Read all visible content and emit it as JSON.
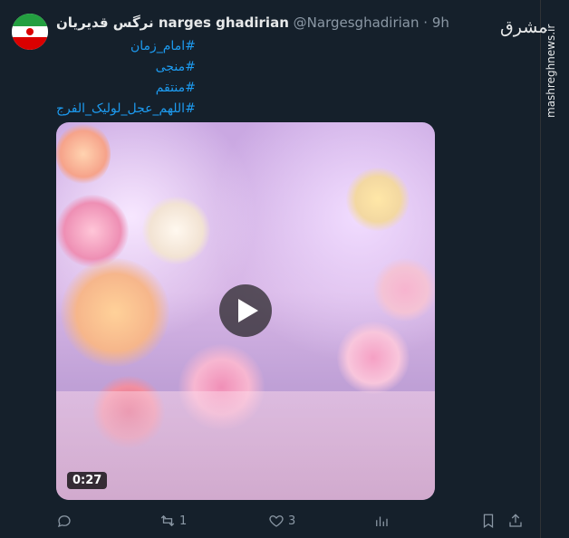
{
  "tweet": {
    "display_name": "نرگس قدیریان narges ghadirian",
    "handle": "@Nargesghadirian",
    "separator": "·",
    "time": "9h",
    "hashtags": [
      "#امام_زمان",
      "#منجی",
      "#منتقم",
      "#اللهم_عجل_لولیک_الفرج"
    ]
  },
  "media": {
    "duration": "0:27"
  },
  "actions": {
    "reply_count": "",
    "retweet_count": "1",
    "like_count": "3",
    "views_count": ""
  },
  "watermark": {
    "logo_text": "مشرق",
    "url": "mashreghnews.ir"
  },
  "colors": {
    "background": "#15202b",
    "link": "#1d9bf0",
    "muted": "#8b98a5"
  }
}
